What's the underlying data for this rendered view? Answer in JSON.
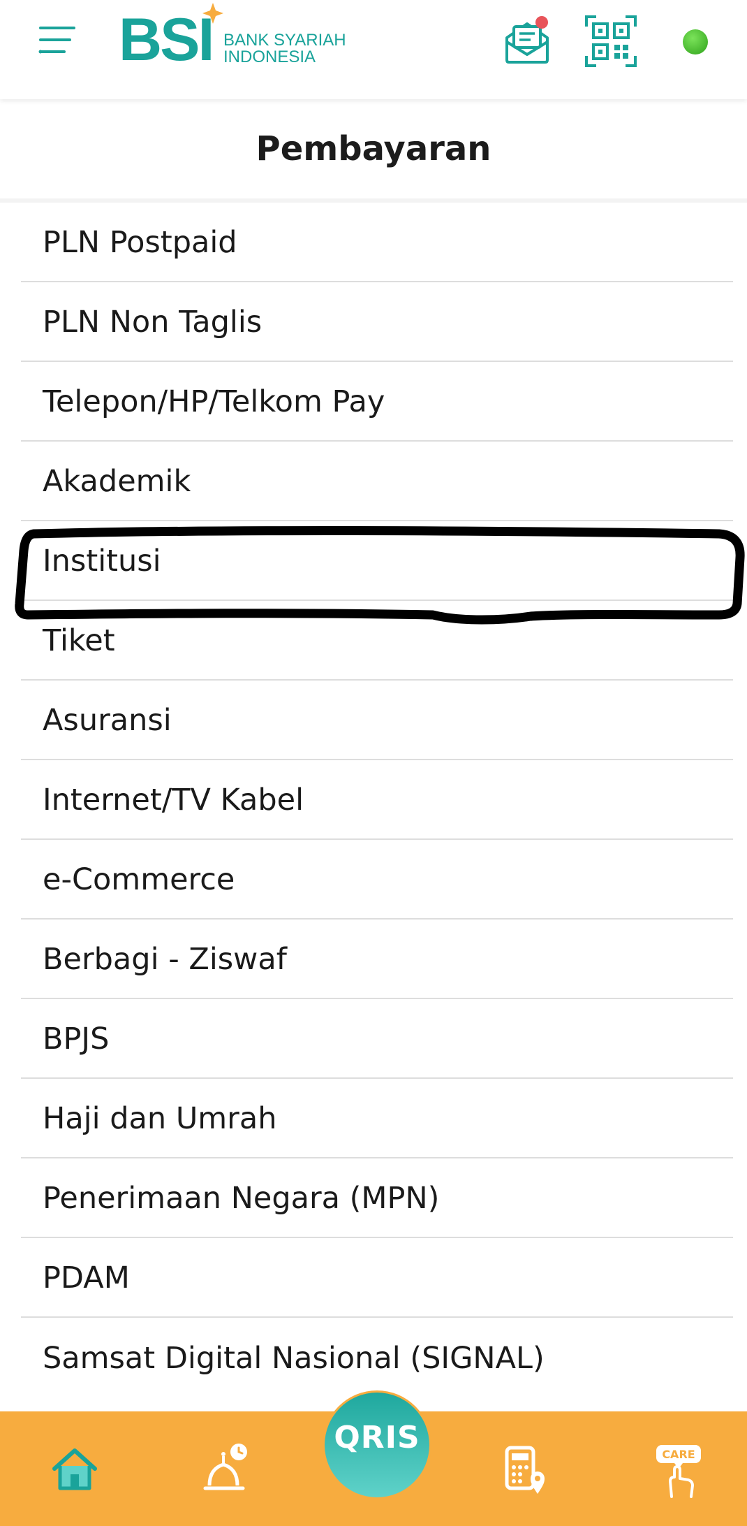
{
  "header": {
    "logo_mark": "BSI",
    "logo_text_line1": "BANK SYARIAH",
    "logo_text_line2": "INDONESIA"
  },
  "page": {
    "title": "Pembayaran"
  },
  "menu_items": [
    "PLN Postpaid",
    "PLN Non Taglis",
    "Telepon/HP/Telkom Pay",
    "Akademik",
    "Institusi",
    "Tiket",
    "Asuransi",
    "Internet/TV Kabel",
    "e-Commerce",
    "Berbagi - Ziswaf",
    "BPJS",
    "Haji dan Umrah",
    "Penerimaan Negara (MPN)",
    "PDAM",
    "Samsat Digital Nasional (SIGNAL)"
  ],
  "bottom_nav": {
    "qris_label": "QRIS",
    "care_label": "CARE"
  },
  "colors": {
    "brand_teal": "#1aa39a",
    "nav_orange": "#f7ac3f",
    "highlight_stroke": "#000000",
    "status_green": "#3fbf2a",
    "notification_red": "#e8545a"
  },
  "icons": [
    "hamburger-menu-icon",
    "envelope-notification-icon",
    "qr-scan-icon",
    "home-icon",
    "mosque-time-icon",
    "calculator-location-icon",
    "care-hand-icon"
  ]
}
